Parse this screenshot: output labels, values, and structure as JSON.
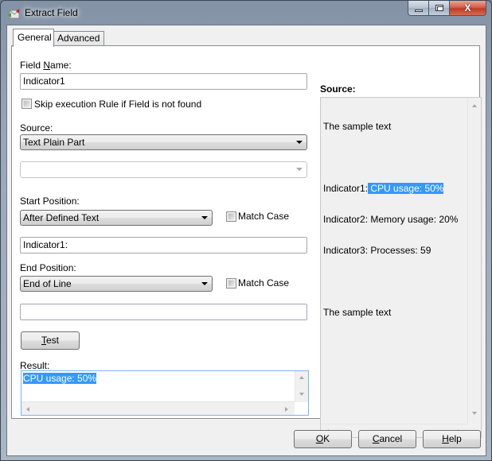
{
  "window": {
    "title": "Extract Field",
    "app_icon": "extract-field-icon",
    "controls": {
      "minimize": "minimize-icon",
      "maximize": "maximize-icon",
      "close": "close-icon",
      "close_glyph": "X"
    }
  },
  "tabs": [
    {
      "label": "General",
      "active": true
    },
    {
      "label": "Advanced",
      "active": false
    }
  ],
  "form": {
    "field_name_label_pre": "Field ",
    "field_name_label_mn": "N",
    "field_name_label_post": "ame:",
    "field_name_value": "Indicator1",
    "skip_checkbox_label": "Skip execution Rule if Field is not found",
    "skip_checked": false,
    "source_label": "Source:",
    "source_value": "Text Plain Part",
    "sub_source_value": "",
    "start_position_label": "Start Position:",
    "start_position_value": "After Defined Text",
    "start_match_case_label": "Match Case",
    "start_match_case_checked": false,
    "start_text_value": "Indicator1:",
    "end_position_label": "End Position:",
    "end_position_value": "End of Line",
    "end_match_case_label": "Match Case",
    "end_match_case_checked": false,
    "end_text_value": "",
    "test_button_mn": "T",
    "test_button_rest": "est",
    "result_label": "Result:",
    "result_value": "CPU usage: 50%"
  },
  "source_panel": {
    "title": "Source:",
    "lines": [
      {
        "text": "The sample text"
      },
      {
        "text": ""
      },
      {
        "prefix": "Indicator1:",
        "highlight": " CPU usage: 50%"
      },
      {
        "text": "Indicator2: Memory usage: 20%"
      },
      {
        "text": "Indicator3: Processes: 59"
      },
      {
        "text": ""
      },
      {
        "text": "The sample text"
      }
    ],
    "highlight_color": "#3399ff"
  },
  "footer": {
    "ok_mn": "O",
    "ok_rest": "K",
    "cancel_mn": "C",
    "cancel_rest": "ancel",
    "help_mn": "H",
    "help_rest": "elp"
  }
}
